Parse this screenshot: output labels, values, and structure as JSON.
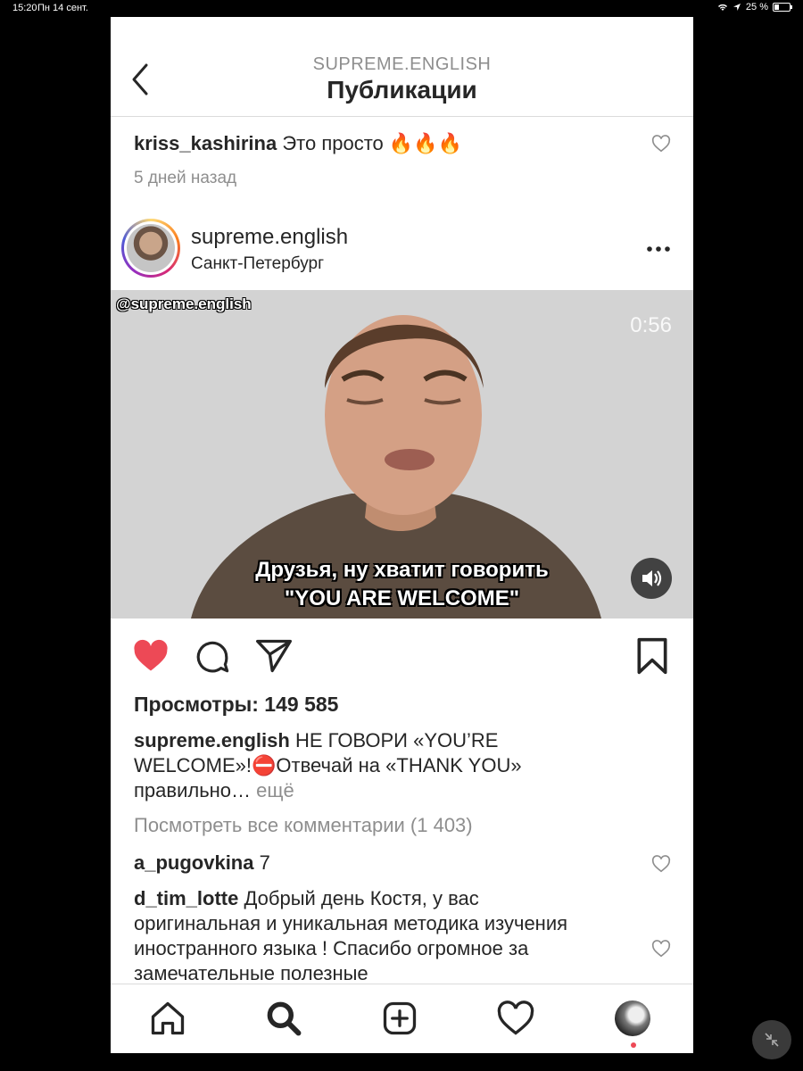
{
  "status_bar": {
    "time": "15:20",
    "date": "Пн 14 сент.",
    "battery": "25 %",
    "battery_level": 0.25
  },
  "nav": {
    "subtitle": "SUPREME.ENGLISH",
    "title": "Публикации"
  },
  "prev_comment": {
    "user": "kriss_kashirina",
    "text": "Это просто 🔥🔥🔥",
    "time": "5 дней назад"
  },
  "post": {
    "username": "supreme.english",
    "location": "Санкт-Петербург",
    "video": {
      "watermark": "@supreme.english",
      "duration": "0:56",
      "subtitle_line1": "Друзья, ну хватит говорить",
      "subtitle_line2": "\"YOU ARE WELCOME\""
    },
    "views_label": "Просмотры: 149 585",
    "caption_user": "supreme.english",
    "caption_text": "НЕ ГОВОРИ «YOU’RE WELCOME»!⛔️Отвечай на «THANK YOU» правильно…",
    "caption_more": "ещё",
    "view_all_comments": "Посмотреть все комментарии (1 403)",
    "comments": [
      {
        "user": "a_pugovkina",
        "text": "7"
      },
      {
        "user": "d_tim_lotte",
        "text": "Добрый день Костя, у вас оригинальная и  уникальная методика изучения иностранного языка ! Спасибо огромное за замечательные полезные"
      }
    ]
  },
  "icons": {
    "back": "chevron-left-icon",
    "like": "heart-filled-icon",
    "comment": "comment-bubble-icon",
    "share": "paper-plane-icon",
    "save": "bookmark-icon",
    "more": "ellipsis-icon",
    "tabs": [
      "home-icon",
      "search-icon",
      "add-post-icon",
      "activity-heart-icon",
      "profile-avatar"
    ]
  },
  "colors": {
    "like": "#ed4956",
    "text": "#262626",
    "muted": "#8e8e8e",
    "divider": "#dbdbdb"
  }
}
